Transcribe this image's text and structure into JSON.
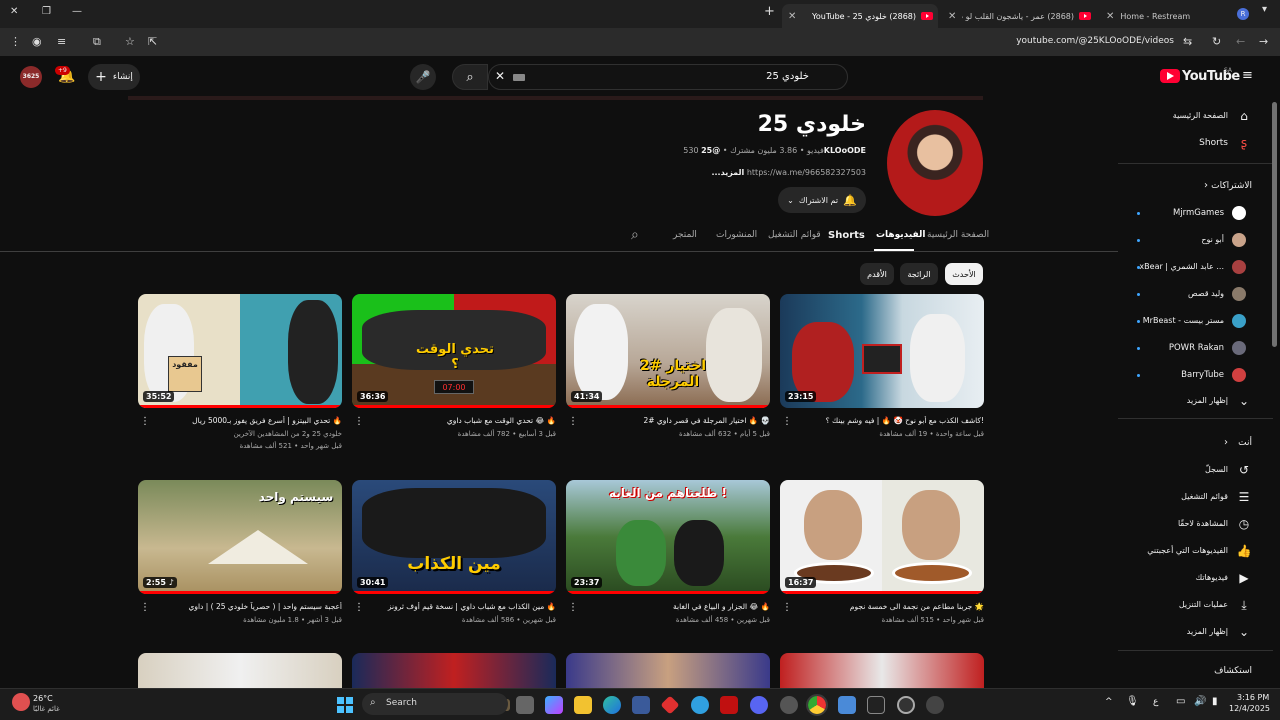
{
  "browser": {
    "tabs": [
      {
        "title": "Home - Restream"
      },
      {
        "title": "(2868) عمر - ياشجون القلب لو ت..."
      },
      {
        "title": "(2868) خلودي 25 - YouTube"
      }
    ],
    "url": "youtube.com/@25KLOoODE/videos"
  },
  "header": {
    "logo": "YouTube",
    "region": "SA",
    "search_value": "خلودي 25",
    "create_label": "إنشاء",
    "notif_count": "+9",
    "avatar_text": "3625"
  },
  "sidebar": {
    "home": "الصفحة الرئيسية",
    "shorts": "Shorts",
    "subs_heading": "الاشتراكات",
    "subs": [
      {
        "name": "MjrmGames",
        "color": "#ffffff"
      },
      {
        "name": "أبو نوح",
        "color": "#c9a38a"
      },
      {
        "name": "xBear | عابد الشمري ...",
        "color": "#a84040"
      },
      {
        "name": "وليد قصص",
        "color": "#8a7a6a"
      },
      {
        "name": "MrBeast - مستر بيست",
        "color": "#3aa0c8"
      },
      {
        "name": "POWR Rakan",
        "color": "#6a6a7a"
      },
      {
        "name": "BarryTube",
        "color": "#d04040"
      }
    ],
    "show_more": "إظهار المزيد",
    "you_heading": "أنت",
    "you_items": [
      {
        "label": "السجلّ",
        "icon": "history-icon"
      },
      {
        "label": "قوائم التشغيل",
        "icon": "playlists-icon"
      },
      {
        "label": "المشاهدة لاحقًا",
        "icon": "watch-later-icon"
      },
      {
        "label": "الفيديوهات التي أعجبتني",
        "icon": "like-icon"
      },
      {
        "label": "فيديوهاتك",
        "icon": "your-videos-icon"
      },
      {
        "label": "عمليات التنزيل",
        "icon": "downloads-icon"
      },
      {
        "label": "إظهار المزيد",
        "icon": "chevron-down-icon"
      }
    ],
    "explore_heading": "استكشاف"
  },
  "channel": {
    "name": "خلودي 25",
    "handle": "@25KLOoODE",
    "subscribers": "3.86 مليون مشترك",
    "videos": "530 فيديو",
    "link": "https://wa.me/966582327503",
    "more": "...المزيد",
    "subscribed_label": "تم الاشتراك",
    "tabs": [
      "الصفحة الرئيسية",
      "الفيديوهات",
      "Shorts",
      "قوائم التشغيل",
      "المنشورات",
      "المتجر"
    ]
  },
  "chips": [
    "الأحدث",
    "الرائجة",
    "الأقدم"
  ],
  "videos": [
    {
      "title": "كاشف الكذب مع أبو نوح 🤡 🔥 | فيه وشم بينك ؟!",
      "views": "19 ألف مشاهدة",
      "time": "قبل ساعة واحدة",
      "duration": "23:15"
    },
    {
      "title": "اختيار المرجلة في قصر داوي #2 🔥 💀",
      "views": "632 ألف مشاهدة",
      "time": "قبل 5 أيام",
      "duration": "41:34"
    },
    {
      "title": "تحدي الوقت مع شباب داوي 😂 🔥",
      "views": "782 ألف مشاهدة",
      "time": "قبل 3 أسابيع",
      "duration": "36:36"
    },
    {
      "title": "تحدي البيتزو | أسرع فريق يفوز بـ5000 ريال 🔥",
      "extra": "خلودي 25 و2 من المشاهدين الآخرين",
      "views": "521 ألف مشاهدة",
      "time": "قبل شهر واحد",
      "duration": "35:52"
    },
    {
      "title": "جربنا مطاعم من نجمة الى خمسة نجوم 🌟",
      "views": "515 ألف مشاهدة",
      "time": "قبل شهر واحد",
      "duration": "16:37"
    },
    {
      "title": "الجزار و البياع في الغابة 😂 🔥",
      "views": "458 ألف مشاهدة",
      "time": "قبل شهرين",
      "duration": "23:37"
    },
    {
      "title": "مين الكذاب مع شباب داوي | نسخة قيم أوف ثرونز 🔥",
      "views": "586 ألف مشاهدة",
      "time": "قبل شهرين",
      "duration": "30:41"
    },
    {
      "title": "أعجبة سيستم واحد | ( حصرياً خلودي 25 ) | داوي",
      "views": "1.8 مليون مشاهدة",
      "time": "قبل 3 أشهر",
      "duration": "2:55"
    }
  ],
  "thumb_text": {
    "v1": "",
    "v2": "اختيار #2 المرجلة",
    "v3": "تحدي الوقت ؟",
    "v3b": "07:00",
    "v4": "مفقود",
    "v5": "",
    "v6": "طلعناهم من الغابه !",
    "v7": "مين الكذاب",
    "v8": "سيستم واحد"
  },
  "taskbar": {
    "temp": "26°C",
    "weather": "غائم غالبًا",
    "search": "Search",
    "time": "3:16 PM",
    "date": "12/4/2025",
    "lang": "ع"
  }
}
